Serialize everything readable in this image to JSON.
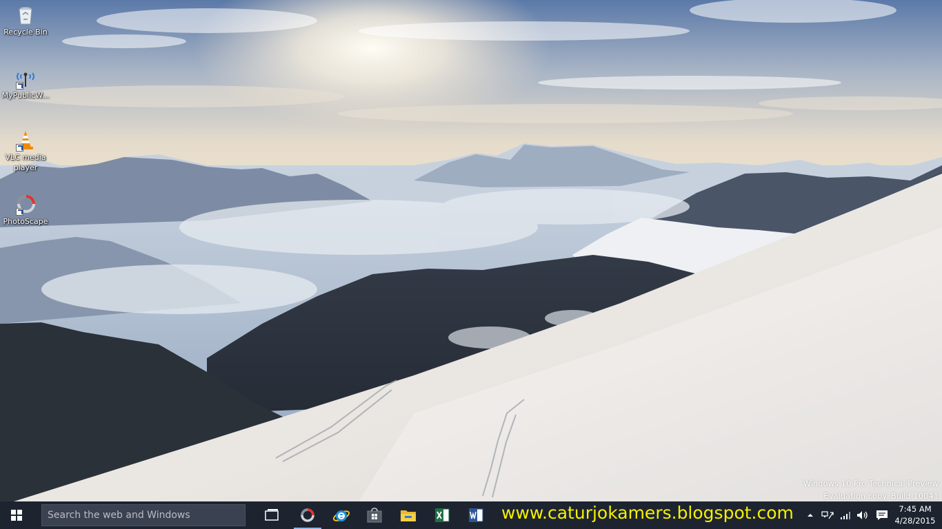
{
  "desktop": {
    "icons": [
      {
        "label": "Recycle Bin",
        "icon": "recycle-bin-icon",
        "shortcut": false
      },
      {
        "label": "MyPublicW...",
        "icon": "wifi-hotspot-icon",
        "shortcut": true
      },
      {
        "label": "VLC media player",
        "icon": "vlc-cone-icon",
        "shortcut": true
      },
      {
        "label": "PhotoScape",
        "icon": "photoscape-icon",
        "shortcut": true
      }
    ]
  },
  "watermark": {
    "line1": "Windows 10 Pro Technical Preview",
    "line2": "Evaluation copy. Build 10041"
  },
  "taskbar": {
    "search_placeholder": "Search the web and Windows",
    "apps": [
      {
        "name": "task-view",
        "icon": "task-view-icon"
      },
      {
        "name": "photoscape",
        "icon": "photoscape-icon",
        "active": true
      },
      {
        "name": "internet-explorer",
        "icon": "internet-explorer-icon"
      },
      {
        "name": "store",
        "icon": "store-icon"
      },
      {
        "name": "file-explorer",
        "icon": "folder-icon"
      },
      {
        "name": "excel",
        "icon": "excel-icon"
      },
      {
        "name": "word",
        "icon": "word-icon"
      }
    ],
    "overlay_text": "www.caturjokamers.blogspot.com",
    "tray": {
      "icons": [
        "chevron-up-icon",
        "network-icon",
        "signal-icon",
        "volume-icon",
        "notifications-icon"
      ]
    },
    "clock": {
      "time": "7:45 AM",
      "date": "4/28/2015"
    }
  },
  "colors": {
    "taskbar_bg": "#1d2430",
    "overlay_text": "#f6f000",
    "accent": "#8db7ea"
  }
}
